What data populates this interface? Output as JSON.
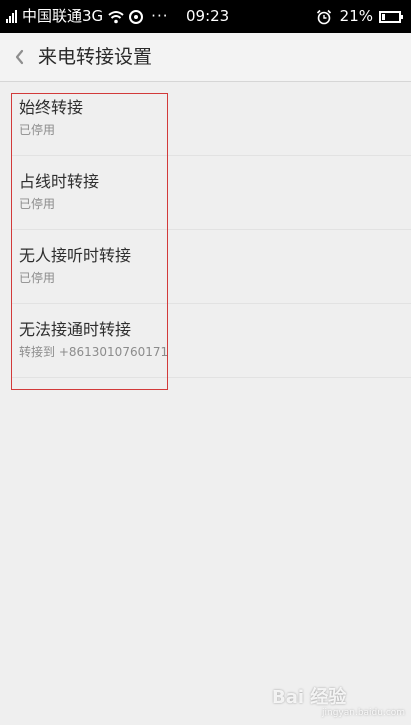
{
  "status_bar": {
    "carrier": "中国联通3G",
    "more": "···",
    "time": "09:23",
    "battery_percent": "21%",
    "battery_level": 0.21
  },
  "header": {
    "back_icon": "chevron-left-icon",
    "title": "来电转接设置"
  },
  "items": [
    {
      "title": "始终转接",
      "subtitle": "已停用"
    },
    {
      "title": "占线时转接",
      "subtitle": "已停用"
    },
    {
      "title": "无人接听时转接",
      "subtitle": "已停用"
    },
    {
      "title": "无法接通时转接",
      "subtitle": "转接到 +8613010760171"
    }
  ],
  "annotation": {
    "highlight_color": "#d23a3a"
  },
  "watermark": {
    "text": "Bai 经验",
    "sub": "jingyan.baidu.com"
  }
}
